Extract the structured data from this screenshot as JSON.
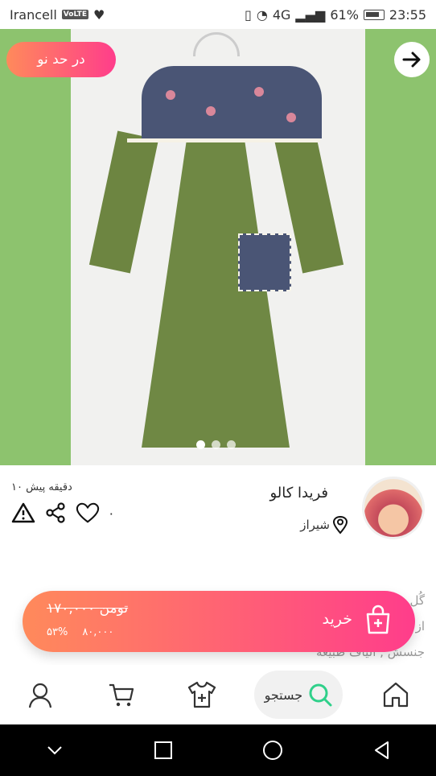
{
  "status_bar": {
    "carrier": "Irancell",
    "volte": "VoLTE",
    "network": "4G",
    "battery": "61%",
    "time": "23:55"
  },
  "hero": {
    "badge": "در حد نو",
    "dots": 3,
    "active_dot": 0
  },
  "listing": {
    "posted": "۱۰ دقیقه پیش",
    "likes": "۰",
    "seller_name": "فریدا کالو",
    "city": "شیراز"
  },
  "description_lines": [
    "گُل",
    "از",
    "جنسش , الیاف طبیعه"
  ],
  "buy": {
    "label": "خرید",
    "old_price": "۱۷۰,۰۰۰ تومن",
    "discount": "۵۳%",
    "new_price": "۸۰,۰۰۰"
  },
  "bottom_nav": {
    "search": "جستجو"
  },
  "colors": {
    "accent_start": "#ff8a5b",
    "accent_end": "#ff3d8b",
    "hero_bg": "#8dc36e"
  },
  "icons": {
    "back": "arrow-right-icon",
    "report": "warning-icon",
    "share": "share-icon",
    "like": "heart-icon",
    "location": "location-pin-icon",
    "buy": "shopping-bag-plus-icon",
    "home": "home-icon",
    "search": "search-icon",
    "add": "add-clothing-icon",
    "cart": "cart-icon",
    "profile": "profile-icon"
  }
}
